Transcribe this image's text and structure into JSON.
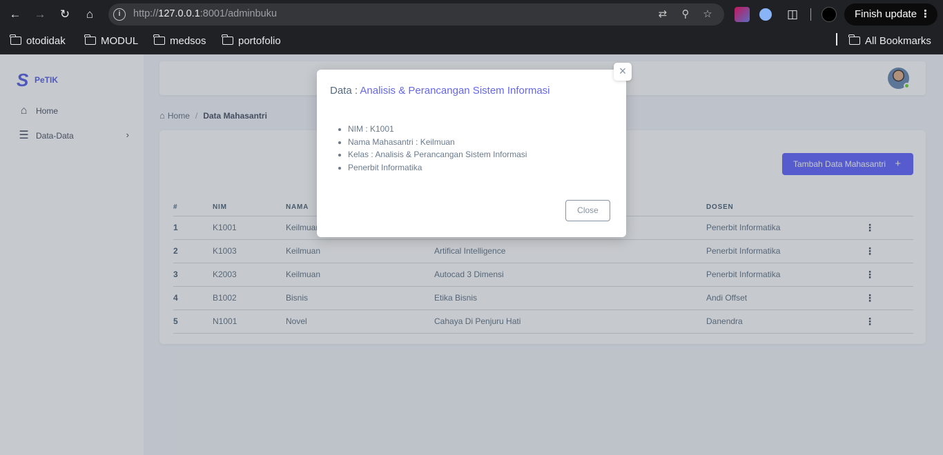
{
  "browser": {
    "url_prefix": "http://",
    "url_host": "127.0.0.1",
    "url_rest": ":8001/adminbuku",
    "finish_update": "Finish update",
    "bookmarks": [
      "otodidak",
      "MODUL",
      "medsos",
      "portofolio"
    ],
    "all_bookmarks": "All Bookmarks"
  },
  "sidebar": {
    "brand": "PeTIK",
    "items": [
      {
        "label": "Home",
        "icon": "house-icon"
      },
      {
        "label": "Data-Data",
        "icon": "layers-icon"
      }
    ]
  },
  "breadcrumb": {
    "home": "Home",
    "separator": "/",
    "current": "Data Mahasantri"
  },
  "add_button": "Tambah Data Mahasantri",
  "table": {
    "headers": [
      "#",
      "NIM",
      "NAMA",
      "",
      "DOSEN",
      ""
    ],
    "rows": [
      {
        "no": "1",
        "nim": "K1001",
        "nama": "Keilmuan",
        "kelas": "",
        "dosen": "Penerbit Informatika"
      },
      {
        "no": "2",
        "nim": "K1003",
        "nama": "Keilmuan",
        "kelas": "Artifical Intelligence",
        "dosen": "Penerbit Informatika"
      },
      {
        "no": "3",
        "nim": "K2003",
        "nama": "Keilmuan",
        "kelas": "Autocad 3 Dimensi",
        "dosen": "Penerbit Informatika"
      },
      {
        "no": "4",
        "nim": "B1002",
        "nama": "Bisnis",
        "kelas": "Etika Bisnis",
        "dosen": "Andi Offset"
      },
      {
        "no": "5",
        "nim": "N1001",
        "nama": "Novel",
        "kelas": "Cahaya Di Penjuru Hati",
        "dosen": "Danendra"
      }
    ]
  },
  "modal": {
    "title_prefix": "Data :",
    "title_value": "Analisis & Perancangan Sistem Informasi",
    "items": [
      "NIM : K1001",
      "Nama Mahasantri : Keilmuan",
      "Kelas : Analisis & Perancangan Sistem Informasi",
      "Penerbit Informatika"
    ],
    "close_label": "Close",
    "close_x": "×"
  },
  "colors": {
    "accent": "#696cff",
    "brand": "#5d67e8",
    "text": "#697a8d"
  }
}
